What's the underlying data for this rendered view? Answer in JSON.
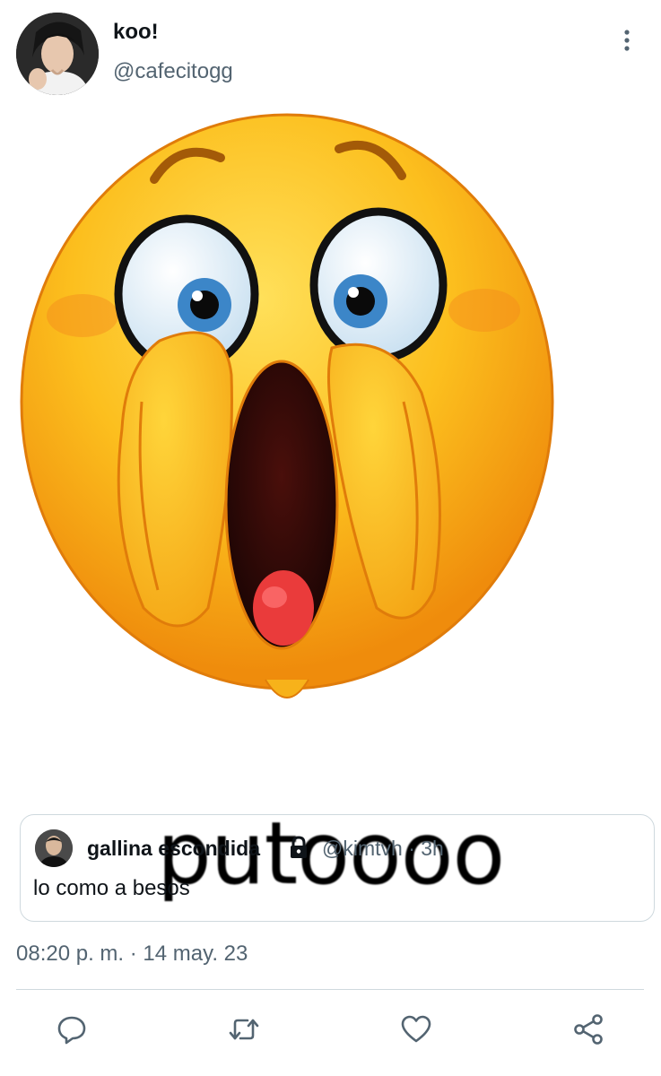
{
  "tweet": {
    "display_name": "koo!",
    "handle": "@cafecitogg",
    "media_caption": "putoooo",
    "timestamp": "08:20 p. m. · 14 may. 23"
  },
  "quoted_tweet": {
    "display_name": "gallina escondida",
    "meta": "@kimtvh · 3h",
    "text": "lo como a besos"
  },
  "icons": {
    "more": "more-vertical-icon",
    "lock": "lock-icon",
    "reply": "reply-icon",
    "retweet": "retweet-icon",
    "like": "heart-icon",
    "share": "share-icon"
  },
  "colors": {
    "text": "#0f1419",
    "secondary": "#536471",
    "border": "#cfd9de",
    "emoji_yellow": "#f7b21a",
    "emoji_orange": "#f09a10"
  }
}
